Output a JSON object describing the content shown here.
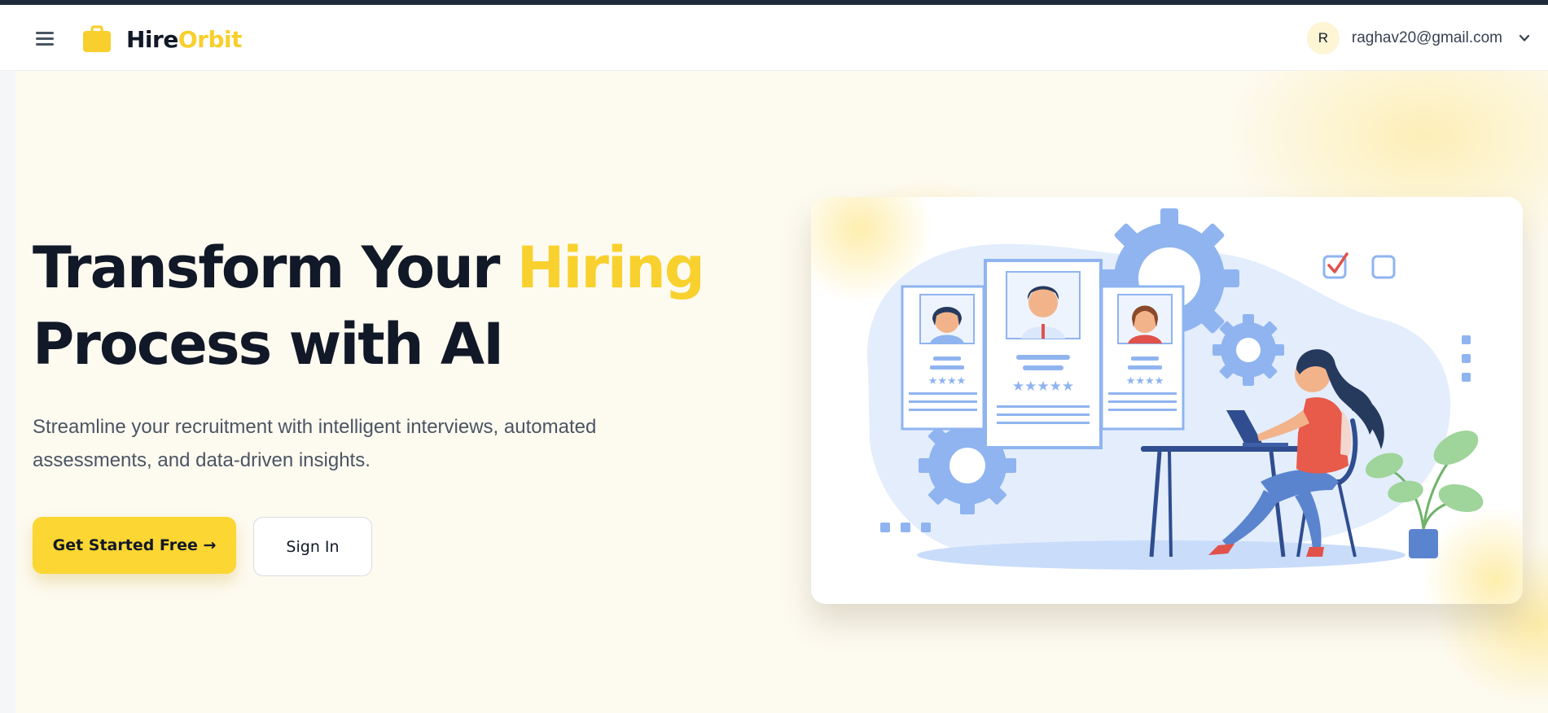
{
  "brand": {
    "name_part1": "Hire",
    "name_part2": "Orbit",
    "logo_icon": "briefcase-icon"
  },
  "header": {
    "menu_icon": "hamburger-menu-icon",
    "user": {
      "avatar_initial": "R",
      "email": "raghav20@gmail.com",
      "dropdown_icon": "chevron-down-icon"
    }
  },
  "hero": {
    "headline_part1": "Transform Your ",
    "headline_accent": "Hiring",
    "headline_part2": "Process with AI",
    "subtext": "Streamline your recruitment with intelligent interviews, automated assessments, and data-driven insights.",
    "primary_button": "Get Started Free →",
    "secondary_button": "Sign In",
    "illustration": "recruiter-reviewing-candidate-profiles-illustration"
  },
  "colors": {
    "accent": "#fcd632",
    "text_dark": "#111827",
    "hero_background": "#fdfaf0",
    "top_strip": "#1e2a3a",
    "illustration_blue": "#8fb4f0"
  }
}
